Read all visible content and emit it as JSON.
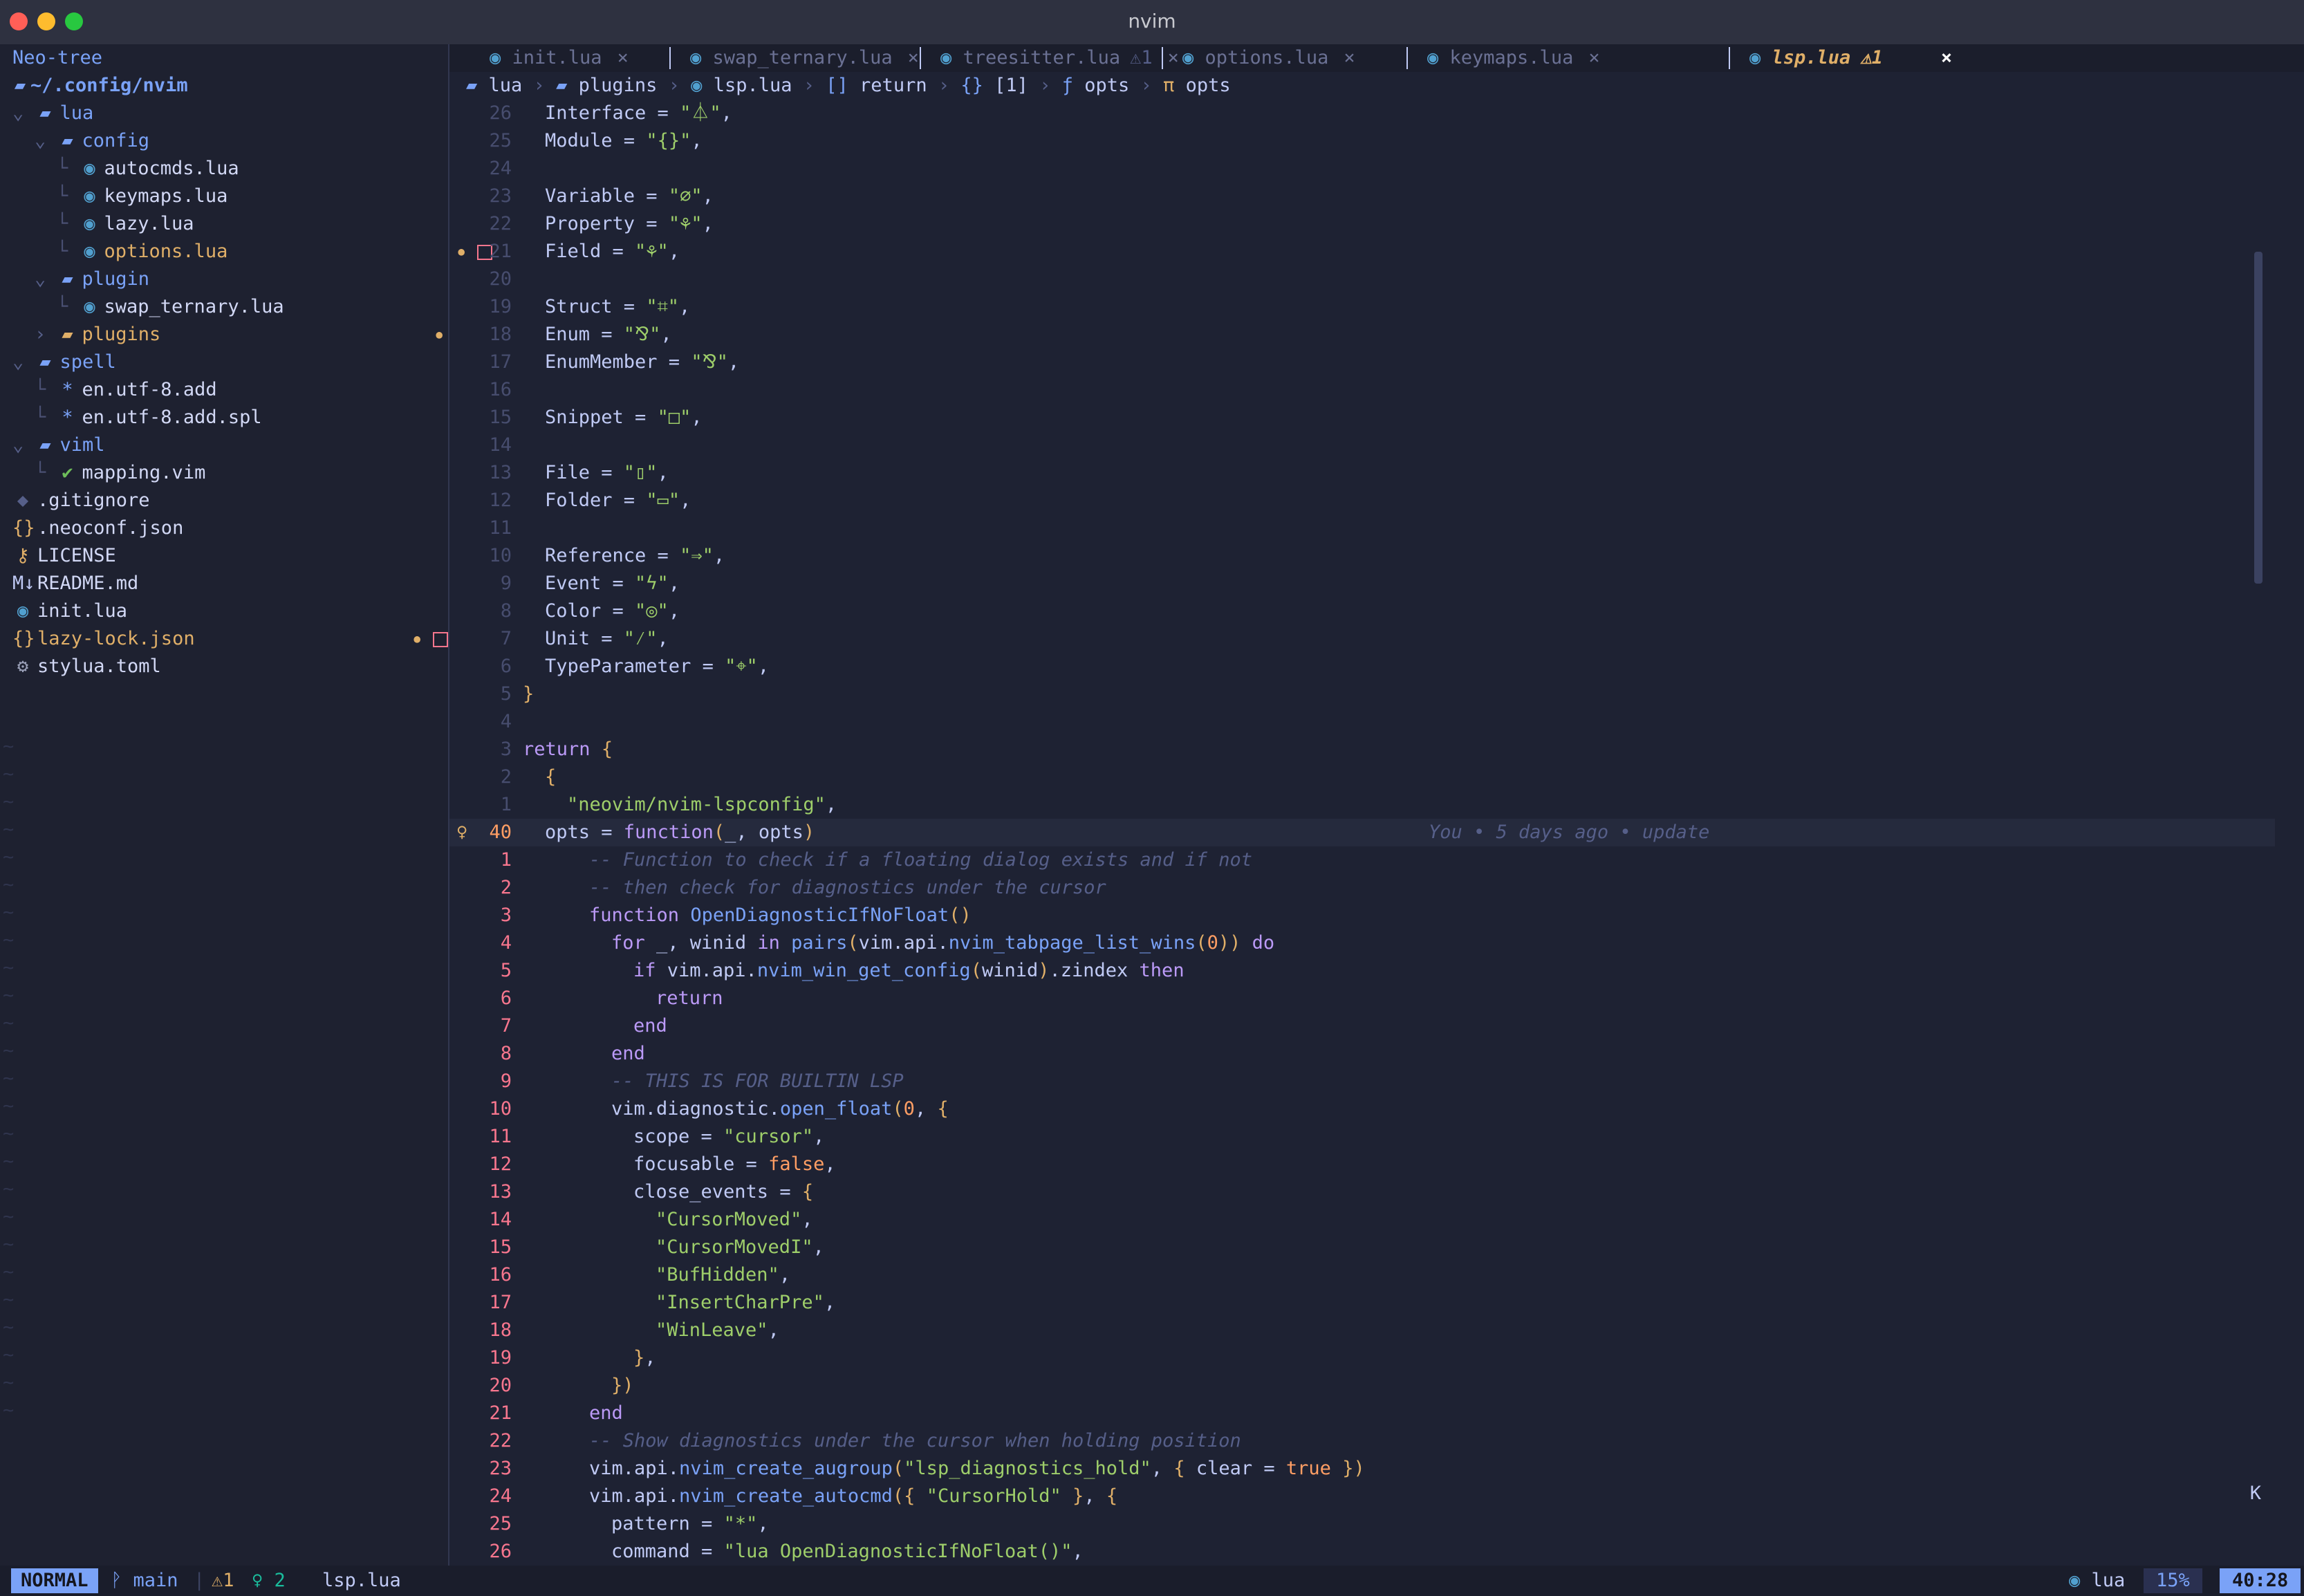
{
  "window": {
    "title": "nvim"
  },
  "sidebar": {
    "header": "Neo-tree",
    "root": "~/.config/nvim",
    "items": [
      {
        "label": "lua",
        "kind": "dir",
        "open": true,
        "depth": 0
      },
      {
        "label": "config",
        "kind": "dir",
        "open": true,
        "depth": 1
      },
      {
        "label": "autocmds.lua",
        "kind": "lua",
        "depth": 2
      },
      {
        "label": "keymaps.lua",
        "kind": "lua",
        "depth": 2
      },
      {
        "label": "lazy.lua",
        "kind": "lua",
        "depth": 2
      },
      {
        "label": "options.lua",
        "kind": "lua-mod",
        "depth": 2
      },
      {
        "label": "plugin",
        "kind": "dir",
        "open": true,
        "depth": 1
      },
      {
        "label": "swap_ternary.lua",
        "kind": "lua",
        "depth": 2
      },
      {
        "label": "plugins",
        "kind": "dir-mod",
        "open": false,
        "depth": 1
      },
      {
        "label": "spell",
        "kind": "dir",
        "open": true,
        "depth": 0
      },
      {
        "label": "en.utf-8.add",
        "kind": "star",
        "depth": 1
      },
      {
        "label": "en.utf-8.add.spl",
        "kind": "star",
        "depth": 1
      },
      {
        "label": "viml",
        "kind": "dir",
        "open": true,
        "depth": 0
      },
      {
        "label": "mapping.vim",
        "kind": "vim",
        "depth": 1
      },
      {
        "label": ".gitignore",
        "kind": "git",
        "depth": 0
      },
      {
        "label": ".neoconf.json",
        "kind": "json",
        "depth": 0
      },
      {
        "label": "LICENSE",
        "kind": "license",
        "depth": 0
      },
      {
        "label": "README.md",
        "kind": "md",
        "depth": 0
      },
      {
        "label": "init.lua",
        "kind": "lua",
        "depth": 0
      },
      {
        "label": "lazy-lock.json",
        "kind": "json-mod",
        "depth": 0
      },
      {
        "label": "stylua.toml",
        "kind": "toml",
        "depth": 0
      }
    ]
  },
  "tabs": [
    {
      "label": "init.lua",
      "close": "×",
      "active": false
    },
    {
      "label": "swap_ternary.lua",
      "close": "×",
      "active": false
    },
    {
      "label": "treesitter.lua",
      "warn": "1",
      "close": "×",
      "active": false
    },
    {
      "label": "options.lua",
      "close": "×",
      "active": false
    },
    {
      "label": "keymaps.lua",
      "close": "×",
      "active": false
    },
    {
      "label": "lsp.lua",
      "warn": "1",
      "close": "×",
      "active": true
    }
  ],
  "breadcrumb": [
    "lua",
    "plugins",
    "lsp.lua",
    "return",
    "[1]",
    "opts",
    "opts"
  ],
  "editor": {
    "lines": [
      {
        "n": "26",
        "t": "Interface = \"⏃\","
      },
      {
        "n": "25",
        "t": "Module = \"{}\","
      },
      {
        "n": "24",
        "t": ""
      },
      {
        "n": "23",
        "t": "Variable = \"⌀\","
      },
      {
        "n": "22",
        "t": "Property = \"⚘\","
      },
      {
        "n": "21",
        "t": "Field = \"⚘\","
      },
      {
        "n": "20",
        "t": ""
      },
      {
        "n": "19",
        "t": "Struct = \"⌗\","
      },
      {
        "n": "18",
        "t": "Enum = \"⅋\","
      },
      {
        "n": "17",
        "t": "EnumMember = \"⅋\","
      },
      {
        "n": "16",
        "t": ""
      },
      {
        "n": "15",
        "t": "Snippet = \"□\","
      },
      {
        "n": "14",
        "t": ""
      },
      {
        "n": "13",
        "t": "File = \"▯\","
      },
      {
        "n": "12",
        "t": "Folder = \"▭\","
      },
      {
        "n": "11",
        "t": ""
      },
      {
        "n": "10",
        "t": "Reference = \"⇒\","
      },
      {
        "n": "9",
        "t": "Event = \"ϟ\","
      },
      {
        "n": "8",
        "t": "Color = \"◎\","
      },
      {
        "n": "7",
        "t": "Unit = \"⁄\","
      },
      {
        "n": "6",
        "t": "TypeParameter = \"⌖\","
      },
      {
        "n": "5",
        "t": "}"
      },
      {
        "n": "4",
        "t": ""
      },
      {
        "n": "3",
        "t": "return {"
      },
      {
        "n": "2",
        "t": "{"
      },
      {
        "n": "1",
        "t": "\"neovim/nvim-lspconfig\","
      },
      {
        "n": "40",
        "t": "opts = function(_, opts)"
      },
      {
        "n": "1",
        "t": "-- Function to check if a floating dialog exists and if not"
      },
      {
        "n": "2",
        "t": "-- then check for diagnostics under the cursor"
      },
      {
        "n": "3",
        "t": "function OpenDiagnosticIfNoFloat()"
      },
      {
        "n": "4",
        "t": "for _, winid in pairs(vim.api.nvim_tabpage_list_wins(0)) do"
      },
      {
        "n": "5",
        "t": "if vim.api.nvim_win_get_config(winid).zindex then"
      },
      {
        "n": "6",
        "t": "return"
      },
      {
        "n": "7",
        "t": "end"
      },
      {
        "n": "8",
        "t": "end"
      },
      {
        "n": "9",
        "t": "-- THIS IS FOR BUILTIN LSP"
      },
      {
        "n": "10",
        "t": "vim.diagnostic.open_float(0, {"
      },
      {
        "n": "11",
        "t": "scope = \"cursor\","
      },
      {
        "n": "12",
        "t": "focusable = false,"
      },
      {
        "n": "13",
        "t": "close_events = {"
      },
      {
        "n": "14",
        "t": "\"CursorMoved\","
      },
      {
        "n": "15",
        "t": "\"CursorMovedI\","
      },
      {
        "n": "16",
        "t": "\"BufHidden\","
      },
      {
        "n": "17",
        "t": "\"InsertCharPre\","
      },
      {
        "n": "18",
        "t": "\"WinLeave\","
      },
      {
        "n": "19",
        "t": "},"
      },
      {
        "n": "20",
        "t": "})"
      },
      {
        "n": "21",
        "t": "end"
      },
      {
        "n": "22",
        "t": "-- Show diagnostics under the cursor when holding position"
      },
      {
        "n": "23",
        "t": "vim.api.nvim_create_augroup(\"lsp_diagnostics_hold\", { clear = true })"
      },
      {
        "n": "24",
        "t": "vim.api.nvim_create_autocmd({ \"CursorHold\" }, {"
      },
      {
        "n": "25",
        "t": "pattern = \"*\","
      },
      {
        "n": "26",
        "t": "command = \"lua OpenDiagnosticIfNoFloat()\","
      }
    ],
    "blame": "You • 5 days ago • update",
    "side_letter": "K"
  },
  "statusline": {
    "mode": "NORMAL",
    "branch": "main",
    "warnings": "1",
    "hints": "2",
    "filename": "lsp.lua",
    "filetype": "lua",
    "percent": "15%",
    "position": "40:28"
  },
  "colors": {
    "accent": "#7aa2f7",
    "warning": "#e0af68",
    "error": "#f7768e",
    "bg": "#1e2233"
  }
}
